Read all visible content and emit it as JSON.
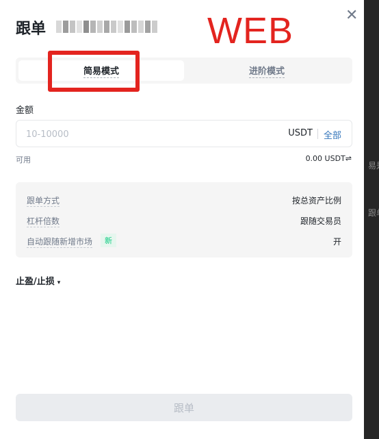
{
  "background_hints": [
    "易是",
    "跟单"
  ],
  "header": {
    "title": "跟单",
    "close_icon": "close-icon"
  },
  "annotation": {
    "label": "WEB",
    "color": "#e3241f"
  },
  "mode_tabs": {
    "simple": "简易模式",
    "advanced": "进阶模式"
  },
  "amount": {
    "label": "金额",
    "placeholder": "10-10000",
    "unit": "USDT",
    "max_label": "全部"
  },
  "available": {
    "label": "可用",
    "value": "0.00 USDT",
    "swap_icon": "⇌"
  },
  "settings": [
    {
      "key": "跟单方式",
      "value": "按总资产比例"
    },
    {
      "key": "杠杆倍数",
      "value": "跟随交易员"
    },
    {
      "key": "自动跟随新增市场",
      "value": "开",
      "badge": "新"
    }
  ],
  "tpsl": {
    "label": "止盈/止损",
    "caret": "▾"
  },
  "submit_label": "跟单",
  "colors": {
    "accent_blue": "#3375bb",
    "badge_green": "#0ecb81",
    "annotation_red": "#e3241f"
  }
}
